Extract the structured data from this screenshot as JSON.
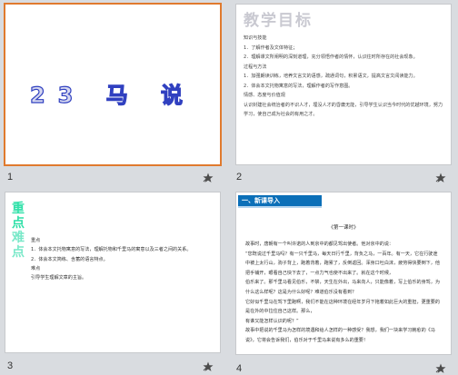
{
  "slides": [
    {
      "number": "1",
      "title": "23 马 说"
    },
    {
      "number": "2",
      "title": "教学目标",
      "lines": [
        "知识与技能",
        "1．了解作者及文体特征；",
        "2．理解课文所阐明的深刻道理，充分领悟作者的情怀，认识往时所存在的社会现象。",
        "过程与方法",
        "1．加强朗读训练，培养文言文的语感，疏通词句，积累语文，提高文言文阅读能力。",
        "2．体会本文托物寓意的写法，理解作者的写作意图。",
        "情感、态度与价值观",
        "认识封建社会统治者的不识人才，埋没人才的昏庸无能，引导学生认识当今时代的优越环境，努力学习，使自己成为社会的有用之才。"
      ]
    },
    {
      "number": "3",
      "vertical_title": [
        "重",
        "点",
        "难",
        "点"
      ],
      "lines": [
        "重点",
        "1．体会本文托物寓意的写法，理解托物和千里马的寓意以及三者之间的关系。",
        "2．体会本文简练、含蓄的语言特点。",
        "难点",
        "引导学生理解文章的主旨。"
      ]
    },
    {
      "number": "4",
      "banner": "一、新课导入",
      "subtitle": "《第一课时》",
      "lines": [
        "故事时，唐朝有一个叫许诺的人到京中的都见驾出使者。他对京中的说：",
        "“您既说过千里马吗？有一只千里马，每天日行千里，背负之马，一百年。有一天，它在行驶途中被上太行山，驹子背上，跑着背着，跑累了，反倒返回。浑身口吐白沫，疲劳得快要倒下，他把手铺开，眼看自己快下去了，一点力气也使不出来了。就在这个时候，",
        "伯乐来了。那千里马看见伯乐，不禁，天生在外出，马来向人，只能像着，写上伯乐的身驾，为什么这么样呢？这是为什么好呢？难道伯乐没有看到？",
        "它好似千里马在驾下里跑啊，我们不能在这种环境在经年岁月下拖着如此巨大的重担，更重要的是在外的中拉住自己这样。那么，",
        "有谁又能怎样认识的呢？”",
        "故事中把说的千里马为怎样的境遇和给人怎样的一种感受？我想，我们一块来学习韩愈的《马说》，它将会告诉我们，伯乐对于千里马来说有多么的重要！"
      ]
    }
  ]
}
